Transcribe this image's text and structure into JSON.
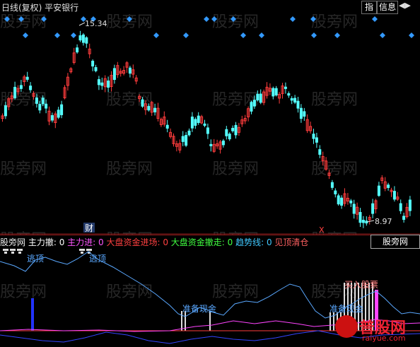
{
  "header": {
    "title": "日线(复权) 平安银行",
    "btn_zhi": "指",
    "btn_info": "信息",
    "nav_arrows": "◀▶"
  },
  "main_chart": {
    "high_label": "15.34",
    "low_label": "8.97",
    "cai_badge": "财",
    "marker_text": "X",
    "watermark": "股旁网",
    "colors": {
      "up": "#ff3c3c",
      "down": "#54ffff",
      "diamond": "#3399ff",
      "frame": "#8a1a1a"
    }
  },
  "indicator": {
    "legend": [
      {
        "text": "股旁网",
        "color": "#e8e8e8"
      },
      {
        "text": " 主力撤: 0",
        "color": "#ffffff"
      },
      {
        "text": " 主力进: 0",
        "color": "#ff55ff"
      },
      {
        "text": " 大盘资金进场: 0",
        "color": "#ff4040"
      },
      {
        "text": " 大盘资金撤走: 0",
        "color": "#40ff40"
      },
      {
        "text": " 趋势线: 0",
        "color": "#40c8ff"
      },
      {
        "text": " 见顶清仓",
        "color": "#ff6060"
      }
    ],
    "site_tab": "股旁网",
    "labels": {
      "top1": "逃顶",
      "top2": "逃顶",
      "prep1": "准备现金",
      "prep2": "准备现金",
      "buy": "买入股票"
    },
    "colors": {
      "trend": "#5aa8ff",
      "zhuli": "#ff44ff",
      "blue_line": "#3344ff",
      "base": "#ff3c3c"
    }
  },
  "brand": {
    "main": "普股网",
    "sub": "raiyue.com"
  }
}
